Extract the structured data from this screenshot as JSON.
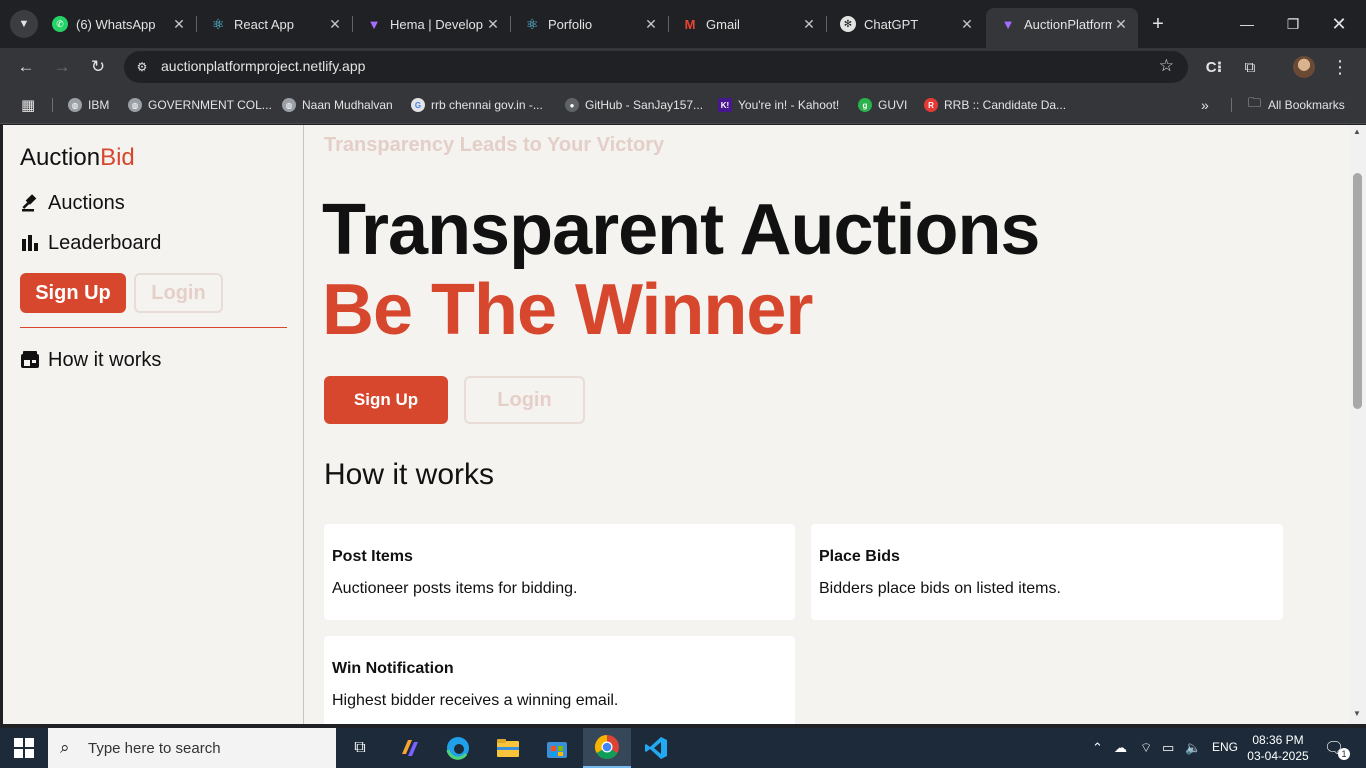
{
  "browser": {
    "tabs": [
      {
        "title": "(6) WhatsApp",
        "icon": "whatsapp-icon",
        "color": "#25d366"
      },
      {
        "title": "React App",
        "icon": "react-icon",
        "color": "#61dafb"
      },
      {
        "title": "Hema | Develop",
        "icon": "vite-icon",
        "color": "#a66bff"
      },
      {
        "title": "Porfolio",
        "icon": "react-icon",
        "color": "#61dafb"
      },
      {
        "title": "Gmail",
        "icon": "gmail-icon",
        "color": "#ea4335"
      },
      {
        "title": "ChatGPT",
        "icon": "chatgpt-icon",
        "color": "#e3e3e3"
      },
      {
        "title": "AuctionPlatform",
        "icon": "vite-icon",
        "color": "#a66bff",
        "active": true
      }
    ],
    "url": "auctionplatformproject.netlify.app",
    "bookmarks": [
      {
        "label": "IBM",
        "icon": "globe-icon"
      },
      {
        "label": "GOVERNMENT COL...",
        "icon": "globe-icon"
      },
      {
        "label": "Naan Mudhalvan",
        "icon": "globe-icon"
      },
      {
        "label": "rrb chennai gov.in -...",
        "icon": "google-icon"
      },
      {
        "label": "GitHub - SanJay157...",
        "icon": "github-icon"
      },
      {
        "label": "You're in! - Kahoot!",
        "icon": "kahoot-icon"
      },
      {
        "label": "GUVI",
        "icon": "guvi-icon"
      },
      {
        "label": "RRB :: Candidate Da...",
        "icon": "rrb-icon"
      }
    ],
    "all_bookmarks": "All Bookmarks"
  },
  "sidebar": {
    "logo_main": "Auction",
    "logo_accent": "Bid",
    "links": [
      {
        "label": "Auctions",
        "icon": "gavel-icon"
      },
      {
        "label": "Leaderboard",
        "icon": "bar-chart-icon"
      }
    ],
    "signup": "Sign Up",
    "login": "Login",
    "how_it_works": "How it works",
    "how_icon": "calendar-store-icon"
  },
  "main": {
    "tagline": "Transparency Leads to Your Victory",
    "hero_line1": "Transparent Auctions",
    "hero_line2": "Be The Winner",
    "signup": "Sign Up",
    "login": "Login",
    "how_title": "How it works",
    "cards": [
      {
        "title": "Post Items",
        "desc": "Auctioneer posts items for bidding."
      },
      {
        "title": "Place Bids",
        "desc": "Bidders place bids on listed items."
      },
      {
        "title": "Win Notification",
        "desc": "Highest bidder receives a winning email."
      }
    ]
  },
  "taskbar": {
    "search_placeholder": "Type here to search",
    "language": "ENG",
    "time": "08:36 PM",
    "date": "03-04-2025",
    "notification_count": "1"
  },
  "colors": {
    "accent": "#d6472d",
    "page_bg": "#f5f3f0"
  }
}
